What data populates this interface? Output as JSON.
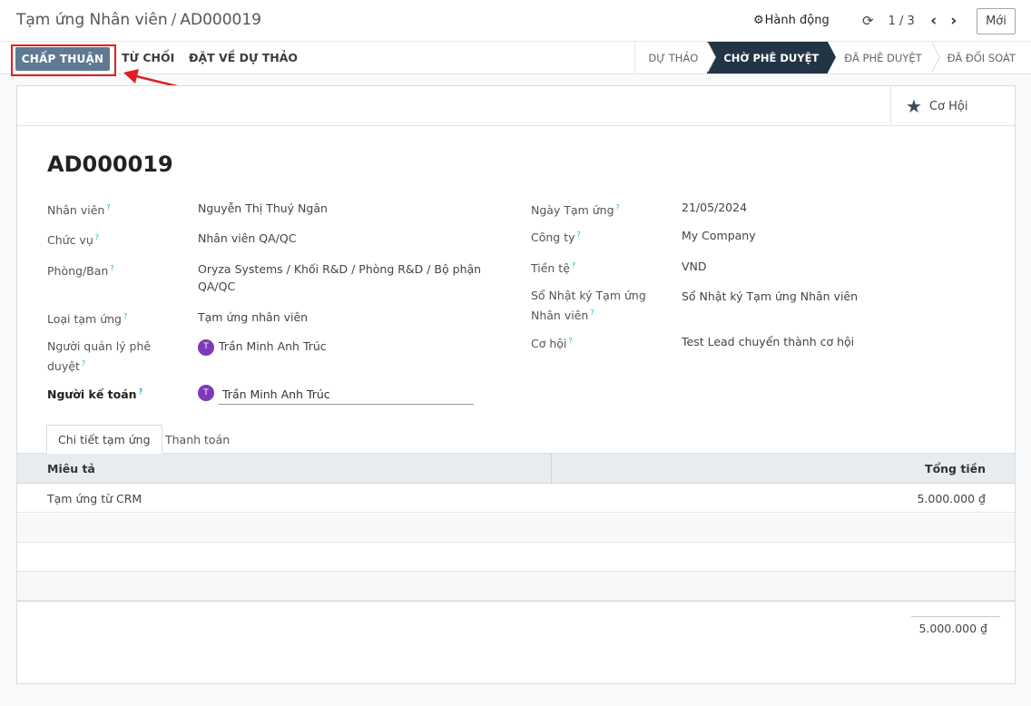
{
  "breadcrumb": {
    "parent": "Tạm ứng Nhân viên",
    "separator": "/",
    "current": "AD000019"
  },
  "control": {
    "action_label": "Hành động",
    "pager": "1 / 3",
    "new_label": "Mới"
  },
  "statusbar": {
    "approve_label": "CHẤP THUẬN",
    "reject_label": "TỪ CHỐI",
    "draft_label": "ĐẶT VỀ DỰ THẢO",
    "stages": [
      "DỰ THẢO",
      "CHỜ PHÊ DUYỆT",
      "ĐÃ PHÊ DUYỆT",
      "ĐÃ ĐỐI SOÁT"
    ],
    "active_stage": "CHỜ PHÊ DUYỆT"
  },
  "smart_button": {
    "label": "Cơ Hội",
    "icon": "star-icon"
  },
  "record": {
    "title": "AD000019"
  },
  "left_fields": {
    "employee": {
      "label": "Nhân viên",
      "value": "Nguyễn Thị Thuý Ngân"
    },
    "position": {
      "label": "Chức vụ",
      "value": "Nhân viên QA/QC"
    },
    "department": {
      "label": "Phòng/Ban",
      "value_line1": "Oryza Systems / Khối R&D / Phòng R&D / Bộ phận",
      "value_line2": "QA/QC"
    },
    "advance_type": {
      "label": "Loại tạm ứng",
      "value": "Tạm ứng nhân viên"
    },
    "approver": {
      "label_line1": "Người quản lý phê",
      "label_line2": "duyệt",
      "value": "Trần Minh Anh Trúc",
      "avatar": "T"
    },
    "accountant": {
      "label": "Người kế toán",
      "value": "Trần Minh Anh Trúc",
      "avatar": "T"
    }
  },
  "right_fields": {
    "date": {
      "label": "Ngày Tạm ứng",
      "value": "21/05/2024"
    },
    "company": {
      "label": "Công ty",
      "value": "My Company"
    },
    "currency": {
      "label": "Tiền tệ",
      "value": "VND"
    },
    "journal": {
      "label_line1": "Sổ Nhật ký Tạm ứng",
      "label_line2": "Nhân viên",
      "value": "Sổ Nhật ký Tạm ứng Nhân viên"
    },
    "opportunity": {
      "label": "Cơ hội",
      "value": "Test Lead chuyển thành cơ hội"
    }
  },
  "tooltip_mark": "?",
  "tabs": [
    "Chi tiết tạm ứng",
    "Thanh toán"
  ],
  "table": {
    "headers": {
      "description": "Miêu tả",
      "total": "Tổng tiền"
    },
    "rows": [
      {
        "description": "Tạm ứng từ CRM",
        "total": "5.000.000 ₫"
      }
    ],
    "grand_total": "5.000.000 ₫"
  },
  "colors": {
    "primary": "#5e7a92",
    "active_stage": "#243447",
    "highlight": "#e02020",
    "avatar": "#7d3ab8",
    "tooltip": "#2ea8c8"
  }
}
